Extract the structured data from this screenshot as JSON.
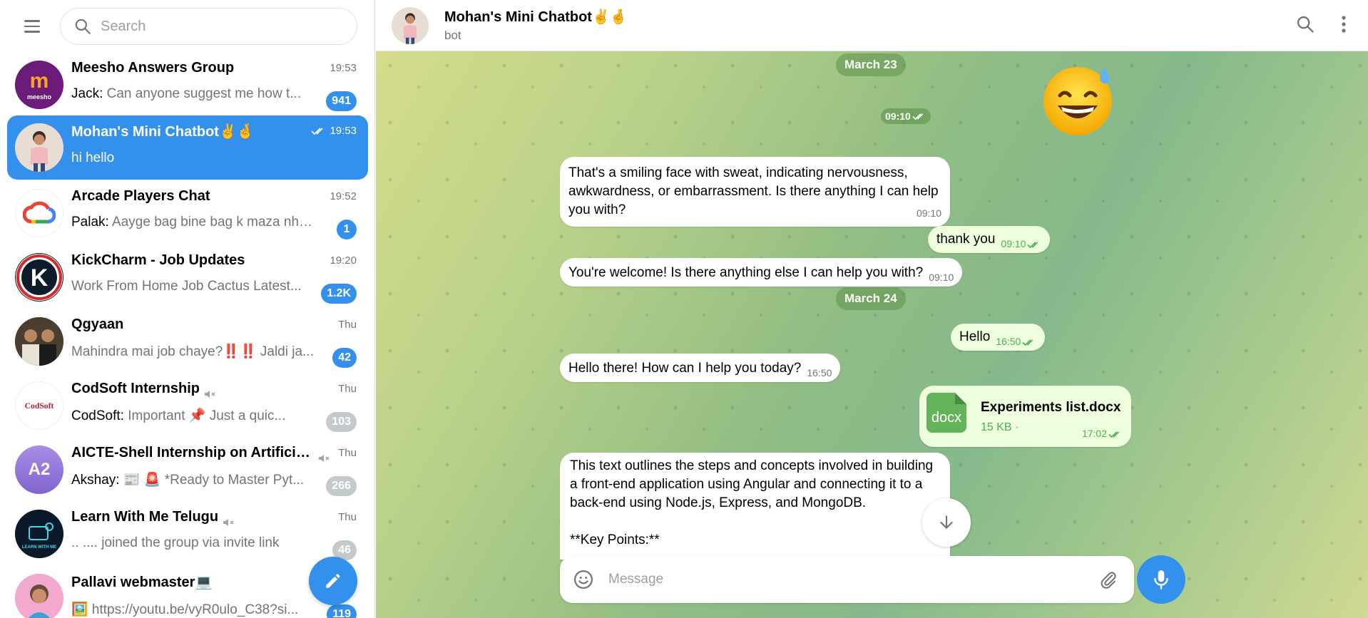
{
  "sidebar": {
    "search_placeholder": "Search",
    "chats": [
      {
        "title": "Meesho Answers Group",
        "time": "19:53",
        "sender": "Jack: ",
        "preview": "Can anyone suggest me how t...",
        "badge": "941",
        "badge_muted": false,
        "avatar_text": "m",
        "avatar_color": "#6d1b7b"
      },
      {
        "title": "Mohan's Mini Chatbot✌️🤞",
        "time": "19:53",
        "sender": "",
        "preview": "hi hello",
        "badge": "",
        "active": true,
        "avatar_color": "#d9c8bd"
      },
      {
        "title": "Arcade Players Chat",
        "time": "19:52",
        "sender": "Palak: ",
        "preview": "Aayge bag bine bag k maza nhi ...",
        "badge": "1",
        "badge_muted": false,
        "avatar_color": "#ffffff"
      },
      {
        "title": "KickCharm - Job Updates",
        "time": "19:20",
        "sender": "",
        "preview": "Work From Home Job Cactus Latest...",
        "badge": "1.2K",
        "badge_muted": false,
        "avatar_text": "K",
        "avatar_color": "#111111"
      },
      {
        "title": "Qgyaan",
        "time": "Thu",
        "sender": "",
        "preview": "Mahindra mai job chaye?‼️‼️ Jaldi ja...",
        "badge": "42",
        "badge_muted": false,
        "avatar_color": "#3a3028"
      },
      {
        "title": "CodSoft Internship",
        "time": "Thu",
        "sender": "CodSoft: ",
        "preview": "Important 📌 Just a quic...",
        "badge": "103",
        "badge_muted": true,
        "muted": true,
        "avatar_text": "CodSoft",
        "avatar_color": "#ffffff"
      },
      {
        "title": "AICTE-Shell Internship on Artificial I...",
        "time": "Thu",
        "sender": "Akshay: ",
        "preview": "📰 🚨 *Ready to Master Pyt...",
        "badge": "266",
        "badge_muted": true,
        "muted": true,
        "avatar_text": "A2",
        "avatar_color": "#9a7ddb"
      },
      {
        "title": "Learn With Me Telugu",
        "time": "Thu",
        "sender": "",
        "preview": ".. .... joined the group via invite link",
        "badge": "46",
        "badge_muted": true,
        "muted": true,
        "avatar_color": "#0a1a2a"
      },
      {
        "title": "Pallavi webmaster💻",
        "time": "",
        "sender": "",
        "preview": "🖼️ https://youtu.be/vyR0ulo_C38?si...",
        "badge": "119",
        "badge_muted": false,
        "avatar_color": "#f0a2c9"
      }
    ]
  },
  "header": {
    "title": "Mohan's Mini Chatbot✌️🤞",
    "subtitle": "bot"
  },
  "messages": {
    "date1": "March 23",
    "emoji_time": "09:10",
    "m1_text": "That's a smiling face with sweat, indicating nervousness, awkwardness, or embarrassment.  Is there anything I can help you with?",
    "m1_time": "09:10",
    "m2_text": "thank you",
    "m2_time": "09:10",
    "m3_text": "You're welcome! Is there anything else I can help you with?",
    "m3_time": "09:10",
    "date2": "March 24",
    "m4_text": "Hello",
    "m4_time": "16:50",
    "m5_text": "Hello there! How can I help you today?",
    "m5_time": "16:50",
    "file_ext": "docx",
    "file_name": "Experiments list.docx",
    "file_size": "15 KB ·",
    "file_time": "17:02",
    "m6_line1": "This text outlines the steps and concepts involved in building a front-end application using Angular and connecting it to a back-end using Node.js, Express, and MongoDB.",
    "m6_line2": "**Key Points:**"
  },
  "composer": {
    "placeholder": "Message"
  },
  "colors": {
    "accent": "#3390ec",
    "outgoing_bubble": "#eeffde",
    "read_tick": "#4fae4e"
  }
}
